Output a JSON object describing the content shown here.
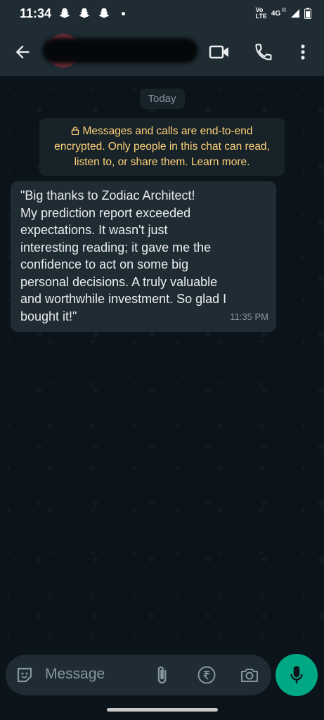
{
  "status_bar": {
    "time": "11:34",
    "network_top": "Vo",
    "network_mid": "LTE",
    "network_type": "4G",
    "roaming": "R"
  },
  "header": {
    "icons": [
      "back-arrow-icon",
      "video-call-icon",
      "voice-call-icon",
      "more-options-icon"
    ]
  },
  "chat": {
    "date_label": "Today",
    "encryption_notice": "Messages and calls are end-to-end encrypted. Only people in this chat can read, listen to, or share them. Learn more.",
    "messages": [
      {
        "text": "\"Big thanks to Zodiac Architect!\nMy prediction report exceeded\nexpectations. It wasn't just\ninteresting reading; it gave me the\nconfidence to act on some big\npersonal decisions. A truly valuable\nand worthwhile investment. So glad I\nbought it!\"",
        "time": "11:35 PM"
      }
    ]
  },
  "input_bar": {
    "placeholder": "Message",
    "icons": [
      "sticker-icon",
      "attachment-icon",
      "rupee-payment-icon",
      "camera-icon",
      "microphone-icon"
    ]
  },
  "colors": {
    "background": "#0b141a",
    "header": "#1f2c34",
    "bubble": "#202c33",
    "accent": "#00a884",
    "encryption_text": "#ffd279"
  }
}
